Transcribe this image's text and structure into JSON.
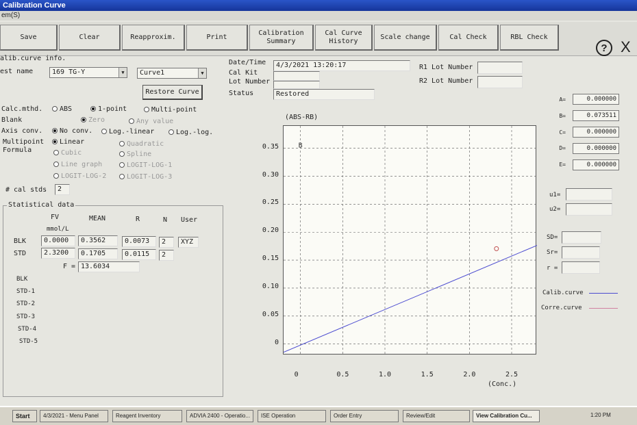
{
  "window": {
    "title": "Calibration Curve",
    "menu": "em(S)"
  },
  "toolbar": {
    "save": "Save",
    "clear": "Clear",
    "reapproxim": "Reapproxim.",
    "print": "Print",
    "cal_summary": "Calibration\nSummary",
    "cal_history": "Cal Curve\nHistory",
    "scale_change": "Scale change",
    "cal_check": "Cal Check",
    "rbl_check": "RBL Check",
    "help": "?",
    "close": "X"
  },
  "info": {
    "section_label": "alib.curve info.",
    "test_name_label": "est name",
    "test_name_value": "169 TG-Y",
    "curve_value": "Curve1",
    "restore_button": "Restore Curve",
    "datetime_label": "Date/Time",
    "datetime_value": "4/3/2021 13:20:17",
    "calkit_label": "Cal Kit",
    "lot_label": "Lot Number",
    "status_label": "Status",
    "status_value": "Restored",
    "r1_label": "R1 Lot Number",
    "r2_label": "R2 Lot Number"
  },
  "method": {
    "calc_label": "Calc.mthd.",
    "abs": "ABS",
    "one_point": "1-point",
    "multi_point": "Multi-point",
    "blank_label": "Blank",
    "zero": "Zero",
    "any_value": "Any value",
    "axis_label": "Axis conv.",
    "no_conv": "No conv.",
    "log_linear": "Log.-linear",
    "log_log": "Log.-log.",
    "multipoint_label": "Multipoint",
    "formula_label": "Formula",
    "linear": "Linear",
    "quadratic": "Quadratic",
    "cubic": "Cubic",
    "spline": "Spline",
    "line_graph": "Line graph",
    "logit_log1": "LOGIT-LOG-1",
    "logit_log2": "LOGIT-LOG-2",
    "logit_log3": "LOGIT-LOG-3",
    "cal_stds_label": "# cal stds",
    "cal_stds_value": "2"
  },
  "stats": {
    "title": "Statistical data",
    "headers": {
      "fv": "FV",
      "mean": "MEAN",
      "r": "R",
      "n": "N",
      "user": "User"
    },
    "unit": "mmol/L",
    "rows": [
      {
        "label": "BLK",
        "fv": "0.0000",
        "mean": "0.3562",
        "r": "0.0073",
        "n": "2",
        "user": "XYZ"
      },
      {
        "label": "STD",
        "fv": "2.3200",
        "mean": "0.1705",
        "r": "0.0115",
        "n": "2",
        "user": ""
      }
    ],
    "f_label": "F =",
    "f_value": "13.6034",
    "list": [
      "BLK",
      "STD-1",
      "STD-2",
      "STD-3",
      "STD-4",
      "STD-5"
    ]
  },
  "chart_data": {
    "type": "line",
    "ylabel": "(ABS-RB)",
    "xlabel": "(Conc.)",
    "xlim": [
      -0.2,
      2.8
    ],
    "ylim": [
      -0.02,
      0.39
    ],
    "x_ticks": [
      "0",
      "0.5",
      "1.0",
      "1.5",
      "2.0",
      "2.5"
    ],
    "y_ticks": [
      "0",
      "0.05",
      "0.10",
      "0.15",
      "0.20",
      "0.25",
      "0.30",
      "0.35"
    ],
    "series": [
      {
        "name": "Calib.curve",
        "color": "#4a4ad0",
        "x": [
          -0.2,
          2.8
        ],
        "y": [
          -0.0147,
          0.1764
        ]
      },
      {
        "name": "Corre.curve",
        "color": "#d080a0",
        "x": [],
        "y": []
      }
    ],
    "points": [
      {
        "x": 2.32,
        "y": 0.1705
      }
    ],
    "blank_marker": {
      "x": 0,
      "y": 0.3562,
      "label": "B"
    }
  },
  "params": {
    "A": "0.000000",
    "B": "0.073511",
    "C": "0.000000",
    "D": "0.000000",
    "E": "0.000000",
    "u1_label": "u1=",
    "u2_label": "u2=",
    "sd_label": "SD=",
    "sr_label": "Sr=",
    "r_label": "r ="
  },
  "legend": {
    "calib": "Calib.curve",
    "corre": "Corre.curve"
  },
  "taskbar": {
    "start": "Start",
    "items": [
      "4/3/2021 - Menu Panel",
      "Reagent Inventory",
      "ADVIA 2400 - Operatio...",
      "ISE Operation",
      "Order Entry",
      "Review/Edit",
      "View Calibration Cu..."
    ],
    "clock": "1:20 PM"
  },
  "colors": {
    "calib_line": "#4a4ad0",
    "corre_line": "#d080a0",
    "titlebar": "#1e44b8"
  }
}
